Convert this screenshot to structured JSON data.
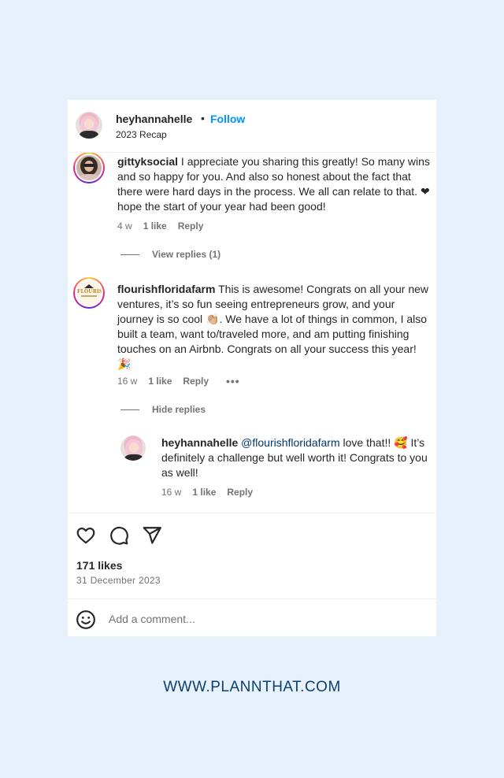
{
  "post": {
    "username": "heyhannahelle",
    "separator": "•",
    "follow_label": "Follow",
    "subtitle": "2023 Recap"
  },
  "comments": [
    {
      "username": "gittyksocial",
      "text": "I appreciate you sharing this greatly! So many wins and so happy for you. And also so honest about the fact that there were hard days in the process. We all can relate to that. ❤ hope the start of your year had been good!",
      "time": "4 w",
      "likes": "1 like",
      "reply_label": "Reply",
      "replies_toggle": "View replies (1)"
    },
    {
      "username": "flourishfloridafarm",
      "avatar_text": "FLOURISH",
      "text": "This is awesome! Congrats on all your new ventures, it’s so fun seeing entrepreneurs grow, and your journey is so cool 👏🏼. We have a lot of things in common, I also built a team, want to/traveled more, and am putting finishing touches on an Airbnb. Congrats on all your success this year! 🎉",
      "time": "16 w",
      "likes": "1 like",
      "reply_label": "Reply",
      "more": "•••",
      "replies_toggle": "Hide replies",
      "reply": {
        "username": "heyhannahelle",
        "mention": "@flourishfloridafarm",
        "text": "love that!! 🥰 It’s definitely a challenge but well worth it! Congrats to you as well!",
        "time": "16 w",
        "likes": "1 like",
        "reply_label": "Reply"
      }
    }
  ],
  "actions": {
    "icons": [
      "heart-icon",
      "comment-icon",
      "share-icon"
    ],
    "likes": "171 likes",
    "date": "31 December 2023"
  },
  "composer": {
    "icon": "emoji-icon",
    "placeholder": "Add a comment..."
  },
  "footer": {
    "url": "WWW.PLANNTHAT.COM"
  },
  "colors": {
    "background": "#e6f1fc",
    "follow": "#0095f6",
    "mention": "#00376b",
    "footer": "#0f3f6e"
  }
}
